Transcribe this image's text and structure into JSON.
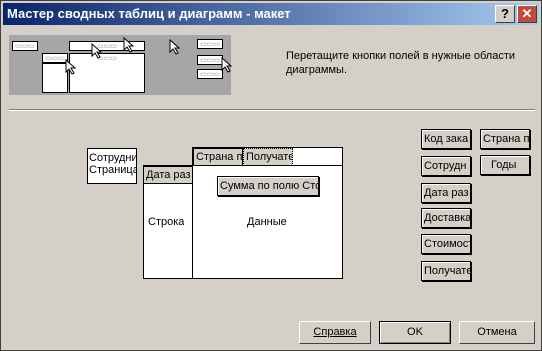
{
  "window": {
    "title": "Мастер сводных таблиц и диаграмм - макет"
  },
  "titlebar": {
    "help_glyph": "?",
    "close_glyph": "✕"
  },
  "preview": {
    "labels": [
      "▭▭▭",
      "▭▭▭",
      "▭▭▭",
      "▭▭▭",
      "▭▭▭",
      "▭▭▭",
      "▭▭▭"
    ]
  },
  "instruction": "Перетащите кнопки полей в нужные области диаграммы.",
  "layout": {
    "page_field_label": "Сотрудник Страница",
    "row_field_label": "Дата раз",
    "row_area_label": "Строка",
    "column_fields": [
      "Страна п",
      "Получате"
    ],
    "data_field_label": "Сумма по полю Сто",
    "data_area_label": "Данные"
  },
  "available_fields": {
    "left": [
      "Код зака",
      "Сотрудн",
      "Дата раз",
      "Доставка",
      "Стоимост",
      "Получате"
    ],
    "right": [
      "Страна п",
      "Годы"
    ]
  },
  "buttons": {
    "help": "Справка",
    "ok": "OK",
    "cancel": "Отмена"
  }
}
